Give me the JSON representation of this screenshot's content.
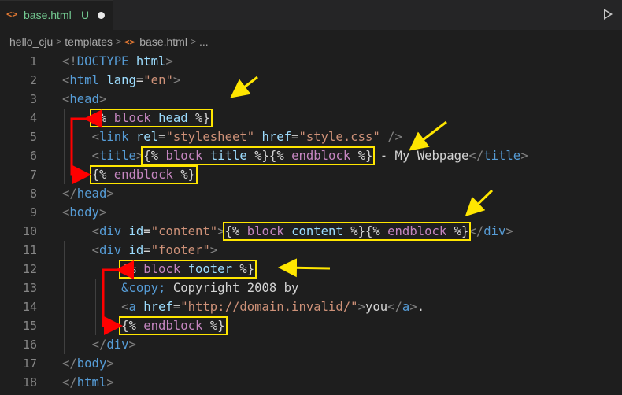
{
  "tab": {
    "icon": "html-file-icon",
    "filename": "base.html",
    "status": "U"
  },
  "breadcrumb": {
    "folder": "hello_cju",
    "subfolder": "templates",
    "file": "base.html",
    "more": "..."
  },
  "colors": {
    "annotation_box": "#ffe600",
    "arrow_red": "#ff0000",
    "arrow_yellow": "#ffe600"
  },
  "lines": [
    {
      "n": "1",
      "tokens": [
        [
          "g",
          "<!"
        ],
        [
          "t",
          "DOCTYPE"
        ],
        [
          "w",
          " "
        ],
        [
          "a",
          "html"
        ],
        [
          "g",
          ">"
        ]
      ]
    },
    {
      "n": "2",
      "tokens": [
        [
          "g",
          "<"
        ],
        [
          "t",
          "html"
        ],
        [
          "w",
          " "
        ],
        [
          "a",
          "lang"
        ],
        [
          "w",
          "="
        ],
        [
          "s",
          "\"en\""
        ],
        [
          "g",
          ">"
        ]
      ]
    },
    {
      "n": "3",
      "tokens": [
        [
          "g",
          "<"
        ],
        [
          "t",
          "head"
        ],
        [
          "g",
          ">"
        ]
      ]
    },
    {
      "n": "4",
      "tokens": [
        [
          "w",
          "    "
        ],
        [
          "hl",
          [
            [
              "w",
              "{% "
            ],
            [
              "k",
              "block"
            ],
            [
              "w",
              " "
            ],
            [
              "v",
              "head"
            ],
            [
              "w",
              " %}"
            ]
          ]
        ]
      ]
    },
    {
      "n": "5",
      "tokens": [
        [
          "w",
          "    "
        ],
        [
          "g",
          "<"
        ],
        [
          "t",
          "link"
        ],
        [
          "w",
          " "
        ],
        [
          "a",
          "rel"
        ],
        [
          "w",
          "="
        ],
        [
          "s",
          "\"stylesheet\""
        ],
        [
          "w",
          " "
        ],
        [
          "a",
          "href"
        ],
        [
          "w",
          "="
        ],
        [
          "s",
          "\"style.css\""
        ],
        [
          "w",
          " "
        ],
        [
          "g",
          "/>"
        ]
      ]
    },
    {
      "n": "6",
      "tokens": [
        [
          "w",
          "    "
        ],
        [
          "g",
          "<"
        ],
        [
          "t",
          "title"
        ],
        [
          "g",
          ">"
        ],
        [
          "hl",
          [
            [
              "w",
              "{% "
            ],
            [
              "k",
              "block"
            ],
            [
              "w",
              " "
            ],
            [
              "v",
              "title"
            ],
            [
              "w",
              " %}{% "
            ],
            [
              "k",
              "endblock"
            ],
            [
              "w",
              " %}"
            ]
          ]
        ],
        [
          "w",
          " - My Webpage"
        ],
        [
          "g",
          "</"
        ],
        [
          "t",
          "title"
        ],
        [
          "g",
          ">"
        ]
      ]
    },
    {
      "n": "7",
      "tokens": [
        [
          "w",
          "    "
        ],
        [
          "hl",
          [
            [
              "w",
              "{% "
            ],
            [
              "k",
              "endblock"
            ],
            [
              "w",
              " %}"
            ]
          ]
        ]
      ]
    },
    {
      "n": "8",
      "tokens": [
        [
          "g",
          "</"
        ],
        [
          "t",
          "head"
        ],
        [
          "g",
          ">"
        ]
      ]
    },
    {
      "n": "9",
      "tokens": [
        [
          "g",
          "<"
        ],
        [
          "t",
          "body"
        ],
        [
          "g",
          ">"
        ]
      ]
    },
    {
      "n": "10",
      "tokens": [
        [
          "w",
          "    "
        ],
        [
          "g",
          "<"
        ],
        [
          "t",
          "div"
        ],
        [
          "w",
          " "
        ],
        [
          "a",
          "id"
        ],
        [
          "w",
          "="
        ],
        [
          "s",
          "\"content\""
        ],
        [
          "g",
          ">"
        ],
        [
          "hl",
          [
            [
              "w",
              "{% "
            ],
            [
              "k",
              "block"
            ],
            [
              "w",
              " "
            ],
            [
              "v",
              "content"
            ],
            [
              "w",
              " %}{% "
            ],
            [
              "k",
              "endblock"
            ],
            [
              "w",
              " %}"
            ]
          ]
        ],
        [
          "g",
          "</"
        ],
        [
          "t",
          "div"
        ],
        [
          "g",
          ">"
        ]
      ]
    },
    {
      "n": "11",
      "tokens": [
        [
          "w",
          "    "
        ],
        [
          "g",
          "<"
        ],
        [
          "t",
          "div"
        ],
        [
          "w",
          " "
        ],
        [
          "a",
          "id"
        ],
        [
          "w",
          "="
        ],
        [
          "s",
          "\"footer\""
        ],
        [
          "g",
          ">"
        ]
      ]
    },
    {
      "n": "12",
      "tokens": [
        [
          "w",
          "        "
        ],
        [
          "hl",
          [
            [
              "w",
              "{% "
            ],
            [
              "k",
              "block"
            ],
            [
              "w",
              " "
            ],
            [
              "v",
              "footer"
            ],
            [
              "w",
              " %}"
            ]
          ]
        ]
      ]
    },
    {
      "n": "13",
      "tokens": [
        [
          "w",
          "        "
        ],
        [
          "e",
          "&copy;"
        ],
        [
          "w",
          " Copyright 2008 by"
        ]
      ]
    },
    {
      "n": "14",
      "tokens": [
        [
          "w",
          "        "
        ],
        [
          "g",
          "<"
        ],
        [
          "t",
          "a"
        ],
        [
          "w",
          " "
        ],
        [
          "a",
          "href"
        ],
        [
          "w",
          "="
        ],
        [
          "s",
          "\"http://domain.invalid/\""
        ],
        [
          "g",
          ">"
        ],
        [
          "w",
          "you"
        ],
        [
          "g",
          "</"
        ],
        [
          "t",
          "a"
        ],
        [
          "g",
          ">"
        ],
        [
          "w",
          "."
        ]
      ]
    },
    {
      "n": "15",
      "tokens": [
        [
          "w",
          "        "
        ],
        [
          "hl",
          [
            [
              "w",
              "{% "
            ],
            [
              "k",
              "endblock"
            ],
            [
              "w",
              " %}"
            ]
          ]
        ]
      ]
    },
    {
      "n": "16",
      "tokens": [
        [
          "w",
          "    "
        ],
        [
          "g",
          "</"
        ],
        [
          "t",
          "div"
        ],
        [
          "g",
          ">"
        ]
      ]
    },
    {
      "n": "17",
      "tokens": [
        [
          "g",
          "</"
        ],
        [
          "t",
          "body"
        ],
        [
          "g",
          ">"
        ]
      ]
    },
    {
      "n": "18",
      "tokens": [
        [
          "g",
          "</"
        ],
        [
          "t",
          "html"
        ],
        [
          "g",
          ">"
        ]
      ]
    }
  ]
}
